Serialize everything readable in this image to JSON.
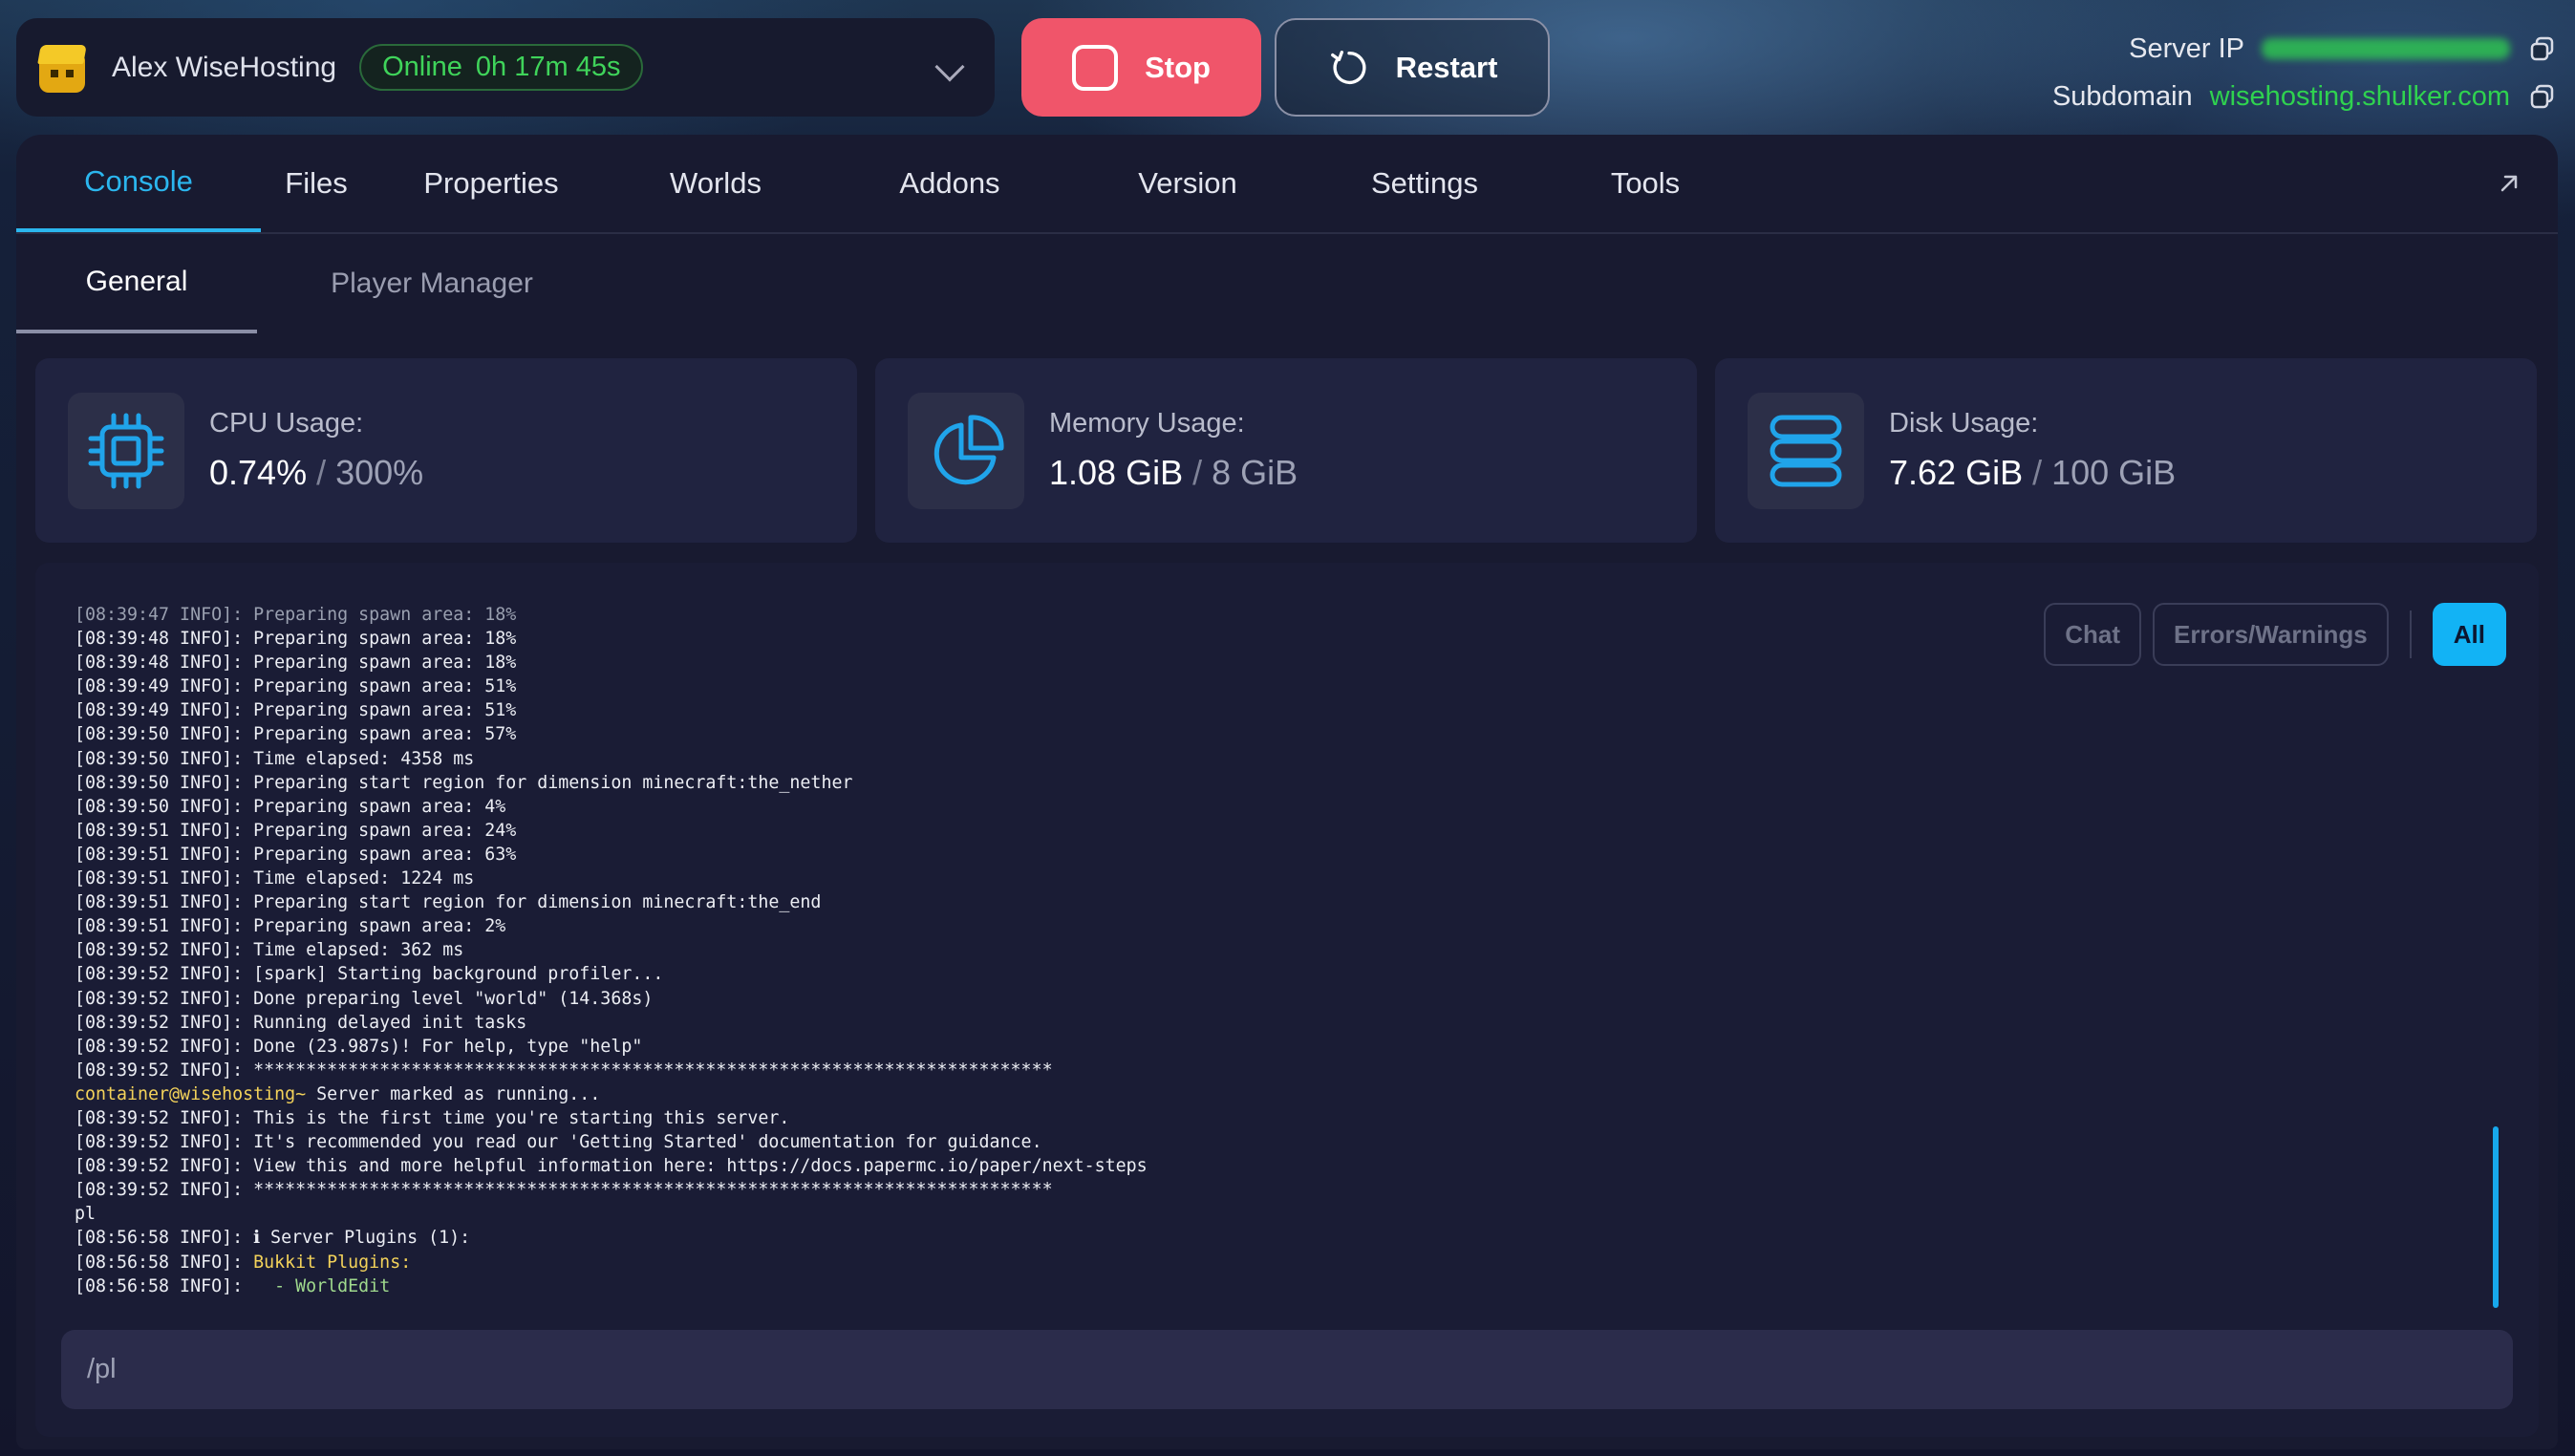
{
  "server": {
    "name": "Alex WiseHosting",
    "status": "Online",
    "uptime": "0h 17m 45s"
  },
  "actions": {
    "stop_label": "Stop",
    "restart_label": "Restart"
  },
  "connection": {
    "ip_label": "Server IP",
    "subdomain_label": "Subdomain",
    "subdomain": "wisehosting.shulker.com"
  },
  "tabs": [
    "Console",
    "Files",
    "Properties",
    "Worlds",
    "Addons",
    "Version",
    "Settings",
    "Tools"
  ],
  "subtabs": [
    "General",
    "Player Manager"
  ],
  "stats": {
    "cpu": {
      "label": "CPU Usage:",
      "value": "0.74%",
      "max": "300%"
    },
    "memory": {
      "label": "Memory Usage:",
      "value": "1.08 GiB",
      "max": "8 GiB"
    },
    "disk": {
      "label": "Disk Usage:",
      "value": "7.62 GiB",
      "max": "100 GiB"
    }
  },
  "filters": [
    "Chat",
    "Errors/Warnings",
    "All"
  ],
  "console_lines": [
    {
      "t": "[08:39:47 INFO]: Preparing spawn area: 18%",
      "c": "dim"
    },
    {
      "t": "[08:39:48 INFO]: Preparing spawn area: 18%",
      "c": ""
    },
    {
      "t": "[08:39:48 INFO]: Preparing spawn area: 18%",
      "c": ""
    },
    {
      "t": "[08:39:49 INFO]: Preparing spawn area: 51%",
      "c": ""
    },
    {
      "t": "[08:39:49 INFO]: Preparing spawn area: 51%",
      "c": ""
    },
    {
      "t": "[08:39:50 INFO]: Preparing spawn area: 57%",
      "c": ""
    },
    {
      "t": "[08:39:50 INFO]: Time elapsed: 4358 ms",
      "c": ""
    },
    {
      "t": "[08:39:50 INFO]: Preparing start region for dimension minecraft:the_nether",
      "c": ""
    },
    {
      "t": "[08:39:50 INFO]: Preparing spawn area: 4%",
      "c": ""
    },
    {
      "t": "[08:39:51 INFO]: Preparing spawn area: 24%",
      "c": ""
    },
    {
      "t": "[08:39:51 INFO]: Preparing spawn area: 63%",
      "c": ""
    },
    {
      "t": "[08:39:51 INFO]: Time elapsed: 1224 ms",
      "c": ""
    },
    {
      "t": "[08:39:51 INFO]: Preparing start region for dimension minecraft:the_end",
      "c": ""
    },
    {
      "t": "[08:39:51 INFO]: Preparing spawn area: 2%",
      "c": ""
    },
    {
      "t": "[08:39:52 INFO]: Time elapsed: 362 ms",
      "c": ""
    },
    {
      "t": "[08:39:52 INFO]: [spark] Starting background profiler...",
      "c": ""
    },
    {
      "t": "[08:39:52 INFO]: Done preparing level \"world\" (14.368s)",
      "c": ""
    },
    {
      "t": "[08:39:52 INFO]: Running delayed init tasks",
      "c": ""
    },
    {
      "t": "[08:39:52 INFO]: Done (23.987s)! For help, type \"help\"",
      "c": ""
    },
    {
      "t": "[08:39:52 INFO]: ****************************************************************************",
      "c": ""
    },
    {
      "t": "Server marked as running...",
      "c": "",
      "prefix": "container@wisehosting~"
    },
    {
      "t": "[08:39:52 INFO]: This is the first time you're starting this server.",
      "c": ""
    },
    {
      "t": "[08:39:52 INFO]: It's recommended you read our 'Getting Started' documentation for guidance.",
      "c": ""
    },
    {
      "t": "[08:39:52 INFO]: View this and more helpful information here: https://docs.papermc.io/paper/next-steps",
      "c": ""
    },
    {
      "t": "[08:39:52 INFO]: ****************************************************************************",
      "c": ""
    },
    {
      "t": "pl",
      "c": ""
    },
    {
      "t": "[08:56:58 INFO]: ",
      "c": "",
      "after": "ℹ Server Plugins (1):"
    },
    {
      "t": "[08:56:58 INFO]: ",
      "c": "",
      "after_yellow": "Bukkit Plugins:"
    },
    {
      "t": "[08:56:58 INFO]:  ",
      "c": "",
      "after_green": " - WorldEdit"
    }
  ],
  "command": {
    "value": "/pl"
  },
  "colors": {
    "accent": "#2bb6ee",
    "stop": "#f0556a",
    "online": "#3fd45a"
  }
}
